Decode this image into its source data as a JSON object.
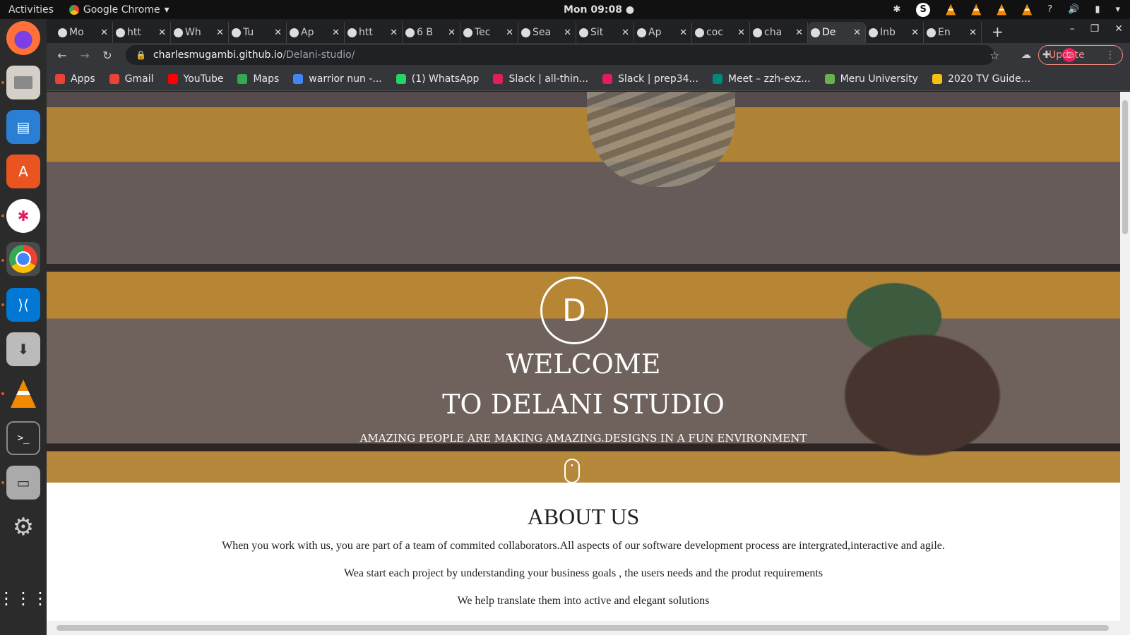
{
  "topbar": {
    "activities": "Activities",
    "app_name": "Google Chrome",
    "clock": "Mon 09:08 ●"
  },
  "dock": {
    "apps": [
      "firefox-icon",
      "files-icon",
      "writer-icon",
      "software-icon",
      "slack-icon",
      "chrome-icon",
      "vscode-icon",
      "installer-icon",
      "vlc-icon",
      "terminal-icon",
      "scanner-icon",
      "settings-icon"
    ],
    "show_apps": "show-apps-icon"
  },
  "tabs": [
    {
      "title": "Mo"
    },
    {
      "title": "htt"
    },
    {
      "title": "Wh"
    },
    {
      "title": "Tu"
    },
    {
      "title": "Ap"
    },
    {
      "title": "htt"
    },
    {
      "title": "6 B"
    },
    {
      "title": "Tec"
    },
    {
      "title": "Sea"
    },
    {
      "title": "Sit"
    },
    {
      "title": "Ap"
    },
    {
      "title": "coc"
    },
    {
      "title": "cha"
    },
    {
      "title": "De"
    },
    {
      "title": "Inb"
    },
    {
      "title": "En"
    }
  ],
  "toolbar": {
    "url_host": "charlesmugambi.github.io",
    "url_path": "/Delani-studio/",
    "avatar_letter": "C",
    "update_label": "Update"
  },
  "bookmarks": [
    "Apps",
    "Gmail",
    "YouTube",
    "Maps",
    "warrior nun -...",
    "(1) WhatsApp",
    "Slack | all-thin...",
    "Slack | prep34...",
    "Meet – zzh-exz...",
    "Meru University",
    "2020 TV Guide..."
  ],
  "hero": {
    "logo_letter": "D",
    "welcome_line1": "WELCOME",
    "welcome_line2": "TO DELANI STUDIO",
    "tagline": "AMAZING PEOPLE ARE MAKING AMAZING.DESIGNS IN A FUN ENVIRONMENT"
  },
  "about": {
    "title": "ABOUT US",
    "paragraphs": [
      "When you work with us, you are part of a team of commited collaborators.All aspects of our software development process are intergrated,interactive and agile.",
      "Wea start each project by understanding your business goals , the users needs and the produt requirements",
      "We help translate them into active and elegant solutions"
    ]
  },
  "colors": {
    "accent_update": "#f28b82",
    "hero_stripe": "#d19e38"
  }
}
